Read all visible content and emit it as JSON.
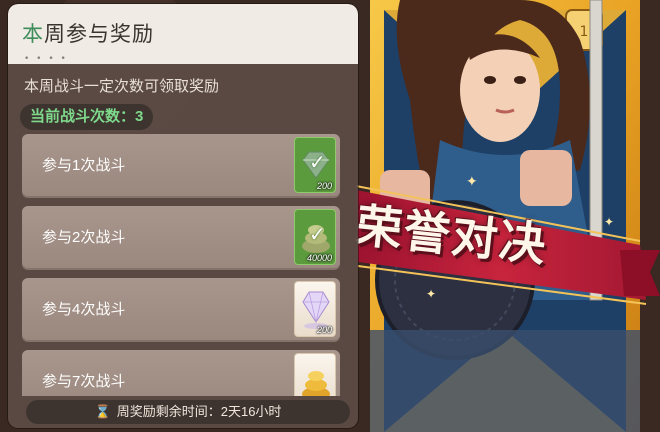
{
  "panel": {
    "title_first": "本",
    "title_rest": "周参与奖励",
    "title_dots": "• • • •",
    "description": "本周战斗一定次数可领取奖励",
    "battle_count_label": "当前战斗次数：3"
  },
  "rewards": [
    {
      "label": "参与1次战斗",
      "amount": "200",
      "claimed": true,
      "icon": "green-gem-icon"
    },
    {
      "label": "参与2次战斗",
      "amount": "40000",
      "claimed": true,
      "icon": "coin-pile-icon"
    },
    {
      "label": "参与4次战斗",
      "amount": "200",
      "claimed": false,
      "icon": "crystal-gem-icon"
    },
    {
      "label": "参与7次战斗",
      "amount": "",
      "claimed": false,
      "icon": "gold-coins-icon"
    }
  ],
  "timer": {
    "icon": "hourglass-icon",
    "text": "周奖励剩余时间：2天16小时"
  },
  "event": {
    "banner_title": "荣誉对决"
  },
  "colors": {
    "accent_green": "#7ed98b",
    "title_green": "#3e8d5a",
    "panel_bg": "#5c4c46",
    "banner_red": "#b8213a"
  }
}
